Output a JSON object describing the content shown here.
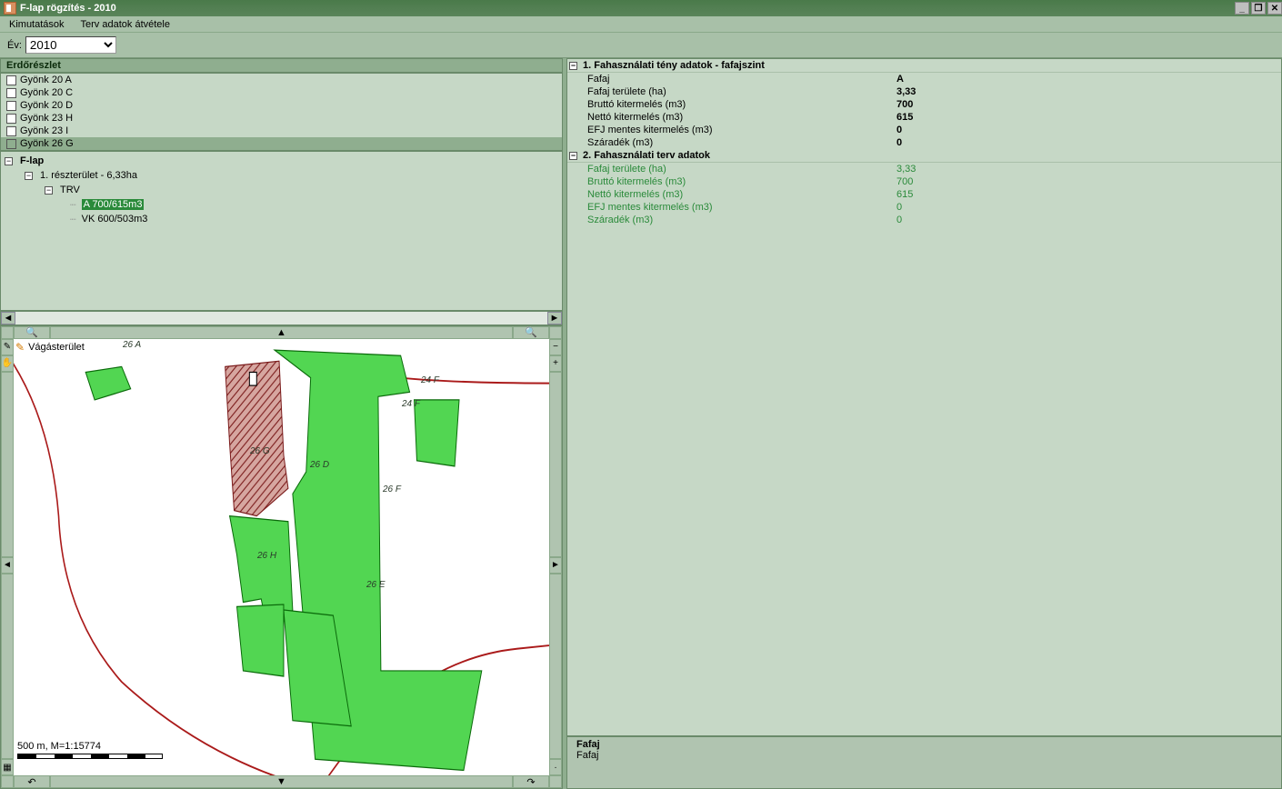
{
  "window": {
    "title": "F-lap rögzítés - 2010"
  },
  "menu": {
    "kimutatasok": "Kimutatások",
    "terv_adatok": "Terv adatok átvétele"
  },
  "toolbar": {
    "year_label": "Év:",
    "year_value": "2010"
  },
  "forest_panel": {
    "header": "Erdőrészlet",
    "items": [
      {
        "label": "Gyönk 20 A"
      },
      {
        "label": "Gyönk 20 C"
      },
      {
        "label": "Gyönk 20 D"
      },
      {
        "label": "Gyönk 23 H"
      },
      {
        "label": "Gyönk 23 I"
      },
      {
        "label": "Gyönk 26 G",
        "selected": true
      }
    ]
  },
  "tree": {
    "root": "F-lap",
    "n1": "1. részterület - 6,33ha",
    "n2": "TRV",
    "leaf_sel": "A 700/615m3",
    "leaf2": "VK 600/503m3"
  },
  "map": {
    "overlay_label": "Vágásterület",
    "scale_label": "500 m, M=1:15774",
    "labels": {
      "l26a": "26 A",
      "l26g": "26 G",
      "l26d": "26 D",
      "l26f": "26 F",
      "l24f": "24 F",
      "l24f2": "24 F",
      "l26h": "26 H",
      "l26e": "26 E"
    }
  },
  "props": {
    "section1": {
      "title": "1. Fahasználati tény adatok - fafajszint",
      "rows": [
        {
          "k": "Fafaj",
          "v": "A"
        },
        {
          "k": "Fafaj területe (ha)",
          "v": "3,33"
        },
        {
          "k": "Bruttó kitermelés (m3)",
          "v": "700"
        },
        {
          "k": "Nettó kitermelés (m3)",
          "v": "615"
        },
        {
          "k": "EFJ mentes kitermelés (m3)",
          "v": "0"
        },
        {
          "k": "Száradék (m3)",
          "v": "0"
        }
      ]
    },
    "section2": {
      "title": "2. Fahasználati terv adatok",
      "rows": [
        {
          "k": "Fafaj területe (ha)",
          "v": "3,33"
        },
        {
          "k": "Bruttó kitermelés (m3)",
          "v": "700"
        },
        {
          "k": "Nettó kitermelés (m3)",
          "v": "615"
        },
        {
          "k": "EFJ mentes kitermelés (m3)",
          "v": "0"
        },
        {
          "k": "Száradék (m3)",
          "v": "0"
        }
      ]
    }
  },
  "bottom_info": {
    "title": "Fafaj",
    "desc": "Fafaj"
  }
}
